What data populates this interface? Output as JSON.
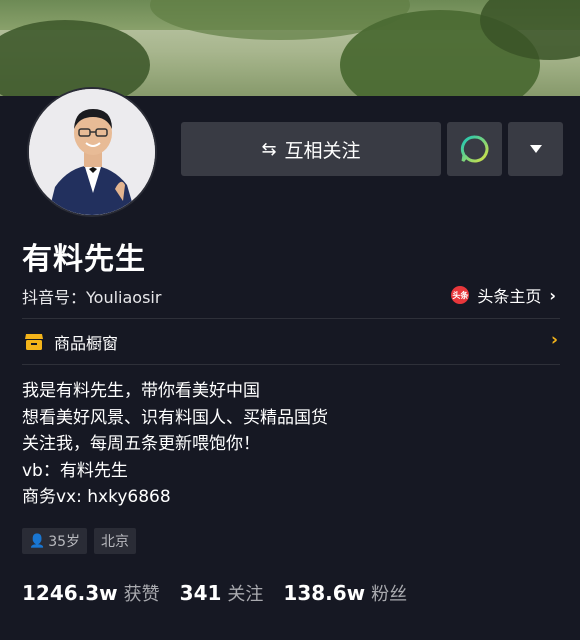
{
  "profile": {
    "name": "有料先生",
    "douyin_id": "抖音号：Youliaosir",
    "toutiao_badge": "头条",
    "toutiao_link": "头条主页"
  },
  "actions": {
    "follow_label": "互相关注",
    "follow_icon": "mutual-follow-icon",
    "message_icon": "chat-bubble-icon",
    "more_icon": "triangle-down-icon"
  },
  "shop": {
    "label": "商品橱窗",
    "icon": "storefront-icon"
  },
  "bio": [
    "我是有料先生，带你看美好中国",
    "想看美好风景、识有料国人、买精品国货",
    "关注我，每周五条更新喂饱你！",
    "vb：有料先生",
    "商务vx: hxky6868"
  ],
  "tags": {
    "age": "35岁",
    "location": "北京"
  },
  "stats": [
    {
      "value": "1246.3w",
      "label": "获赞"
    },
    {
      "value": "341",
      "label": "关注"
    },
    {
      "value": "138.6w",
      "label": "粉丝"
    }
  ],
  "colors": {
    "background": "#161823",
    "button": "#393b44",
    "accent_yellow": "#f4b41a",
    "chat_gradient_start": "#19c5b8",
    "chat_gradient_end": "#d8e243",
    "toutiao_red": "#e8373b"
  }
}
